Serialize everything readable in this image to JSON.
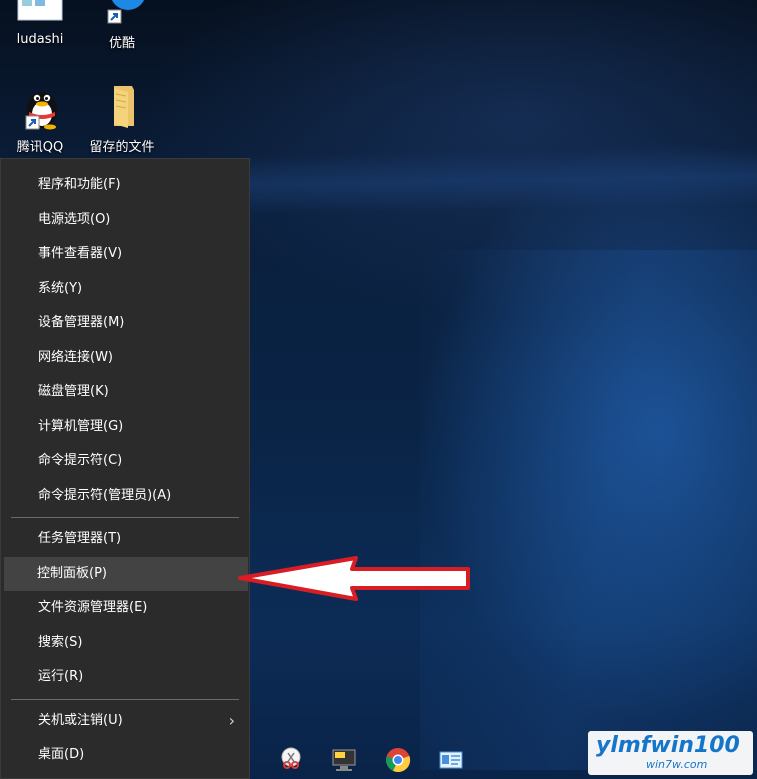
{
  "desktop": {
    "icons": [
      {
        "label": "ludashi"
      },
      {
        "label": "优酷"
      },
      {
        "label": "腾讯QQ"
      },
      {
        "label": "留存的文件"
      }
    ]
  },
  "menu": {
    "items": [
      {
        "label": "程序和功能(F)"
      },
      {
        "label": "电源选项(O)"
      },
      {
        "label": "事件查看器(V)"
      },
      {
        "label": "系统(Y)"
      },
      {
        "label": "设备管理器(M)"
      },
      {
        "label": "网络连接(W)"
      },
      {
        "label": "磁盘管理(K)"
      },
      {
        "label": "计算机管理(G)"
      },
      {
        "label": "命令提示符(C)"
      },
      {
        "label": "命令提示符(管理员)(A)"
      },
      {
        "label": "任务管理器(T)"
      },
      {
        "label": "控制面板(P)"
      },
      {
        "label": "文件资源管理器(E)"
      },
      {
        "label": "搜索(S)"
      },
      {
        "label": "运行(R)"
      },
      {
        "label": "关机或注销(U)"
      },
      {
        "label": "桌面(D)"
      }
    ],
    "highlighted": "控制面板(P)",
    "submenu_indicator": "›"
  },
  "annotation": {
    "arrow_color": "#d81e24"
  },
  "watermark": {
    "brand": "ylmfwin100.com",
    "text": "ylmfwin100",
    "sub": "win7w.com"
  }
}
